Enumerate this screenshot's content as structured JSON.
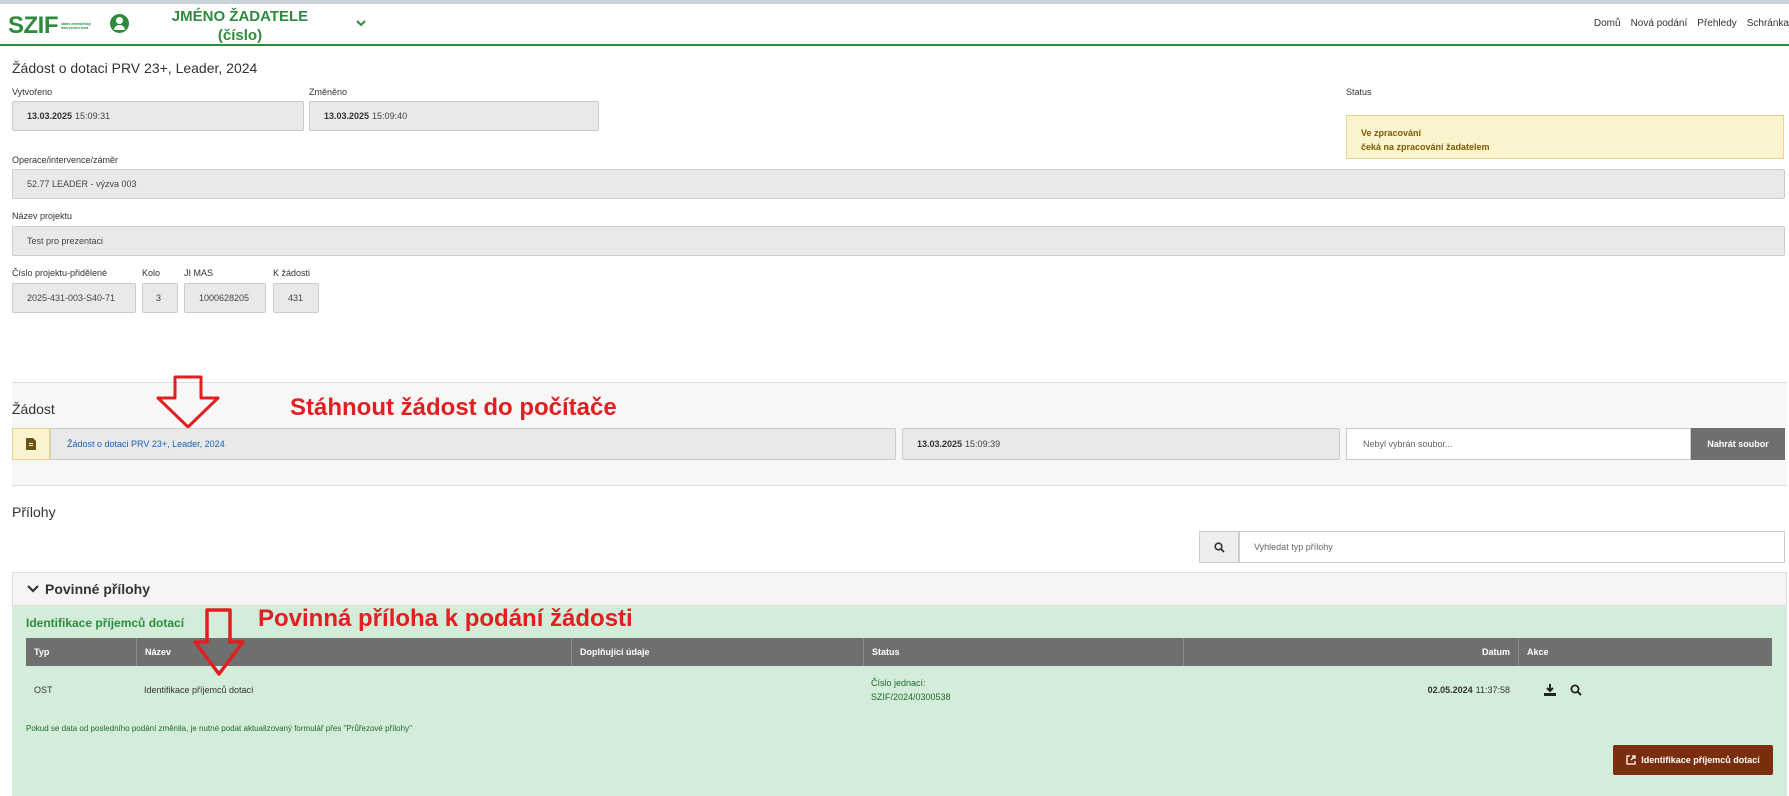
{
  "header": {
    "logo_text": "SZIF",
    "logo_sub": "státní zemědělský intervenční fond",
    "user_name_line1": "JMÉNO ŽADATELE",
    "user_name_line2": "(číslo)",
    "nav": [
      "Domů",
      "Nová podání",
      "Přehledy",
      "Schránka"
    ]
  },
  "form": {
    "title": "Žádost o dotaci PRV 23+, Leader, 2024",
    "created_label": "Vytvořeno",
    "created_date": "13.03.2025",
    "created_time": "15:09:31",
    "changed_label": "Změněno",
    "changed_date": "13.03.2025",
    "changed_time": "15:09:40",
    "status_label": "Status",
    "status_line1": "Ve zpracování",
    "status_line2": "čeká na zpracování žadatelem",
    "operation_label": "Operace/intervence/záměr",
    "operation_value": "52.77 LEADER - výzva 003",
    "project_name_label": "Název projektu",
    "project_name_value": "Test pro prezentaci",
    "project_number_label": "Číslo projektu-přidělené",
    "project_number_value": "2025-431-003-S40-71",
    "kolo_label": "Kolo",
    "kolo_value": "3",
    "jimas_label": "JI MAS",
    "jimas_value": "1000628205",
    "kzadosti_label": "K žádosti",
    "kzadosti_value": "431"
  },
  "zadost": {
    "title": "Žádost",
    "file_link": "Žádost o dotaci PRV 23+, Leader, 2024",
    "file_date": "13.03.2025",
    "file_time": "15:09:39",
    "upload_placeholder": "Nebyl vybrán soubor...",
    "upload_button": "Nahrát soubor",
    "annotation": "Stáhnout žádost do počítače"
  },
  "prilohy": {
    "title": "Přílohy",
    "search_placeholder": "Vyhledat typ přílohy",
    "mandatory_header": "Povinné přílohy",
    "subsection_title": "Identifikace příjemců dotací",
    "annotation": "Povinná příloha k podání žádosti",
    "columns": [
      "Typ",
      "Název",
      "Doplňující údaje",
      "Status",
      "Datum",
      "Akce"
    ],
    "row": {
      "typ": "OST",
      "nazev": "Identifikace příjemců dotací",
      "doplnujici": "",
      "status_line1": "Číslo jednací:",
      "status_line2": "SZIF/2024/0300538",
      "datum_date": "02.05.2024",
      "datum_time": "11:37:58"
    },
    "note": "Pokud se data od posledního podání změnila, je nutné podat aktualizovaný formulář přes \"Průřezové přílohy\"",
    "ident_button": "Identifikace příjemců dotací"
  },
  "colors": {
    "brand_green": "#2e8b3e",
    "status_bg": "#fcf3cf",
    "annotation_red": "#e02020",
    "attachment_bg": "#d4ecda",
    "ident_button_bg": "#7a2e0e"
  }
}
